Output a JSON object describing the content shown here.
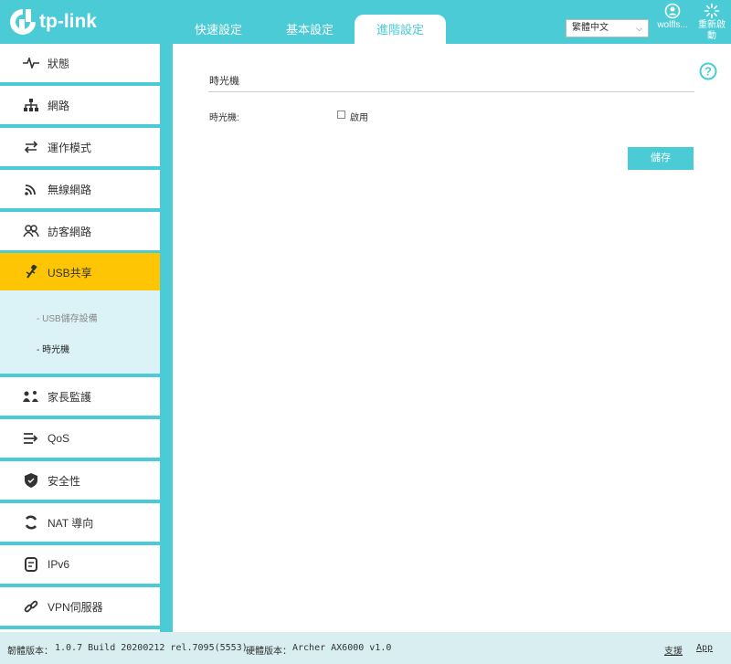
{
  "header": {
    "logo_text": "tp-link",
    "tabs": [
      {
        "label": "快速設定"
      },
      {
        "label": "基本設定"
      },
      {
        "label": "進階設定"
      }
    ],
    "language": "繁體中文",
    "user_label": "wolfls...",
    "reboot_label": "重新啟動",
    "colors": {
      "accent": "#4acbd6",
      "active_nav": "#fdc503",
      "submenu_bg": "#dbf3f6"
    }
  },
  "sidebar": {
    "items": [
      {
        "label": "狀態",
        "icon": "pulse-icon"
      },
      {
        "label": "網路",
        "icon": "network-icon"
      },
      {
        "label": "運作模式",
        "icon": "swap-icon"
      },
      {
        "label": "無線網路",
        "icon": "wireless-icon"
      },
      {
        "label": "訪客網路",
        "icon": "guests-icon"
      },
      {
        "label": "USB共享",
        "icon": "usb-icon"
      },
      {
        "label": "家長監護",
        "icon": "family-icon"
      },
      {
        "label": "QoS",
        "icon": "qos-icon"
      },
      {
        "label": "安全性",
        "icon": "shield-icon"
      },
      {
        "label": "NAT 導向",
        "icon": "nat-icon"
      },
      {
        "label": "IPv6",
        "icon": "ipv6-icon"
      },
      {
        "label": "VPN伺服器",
        "icon": "link-icon"
      }
    ],
    "submenu": [
      {
        "label": "- USB儲存設備"
      },
      {
        "label": "- 時光機"
      }
    ]
  },
  "main": {
    "section_title": "時光機",
    "field_label": "時光機:",
    "checkbox_label": "啟用",
    "checkbox_checked": false,
    "save_label": "儲存"
  },
  "footer": {
    "firmware_label": "韌體版本：",
    "firmware_value": "1.0.7 Build 20200212 rel.7095(5553)",
    "hardware_label": "硬體版本：",
    "hardware_value": "Archer AX6000 v1.0",
    "support_label": "支援",
    "app_label": "App"
  }
}
